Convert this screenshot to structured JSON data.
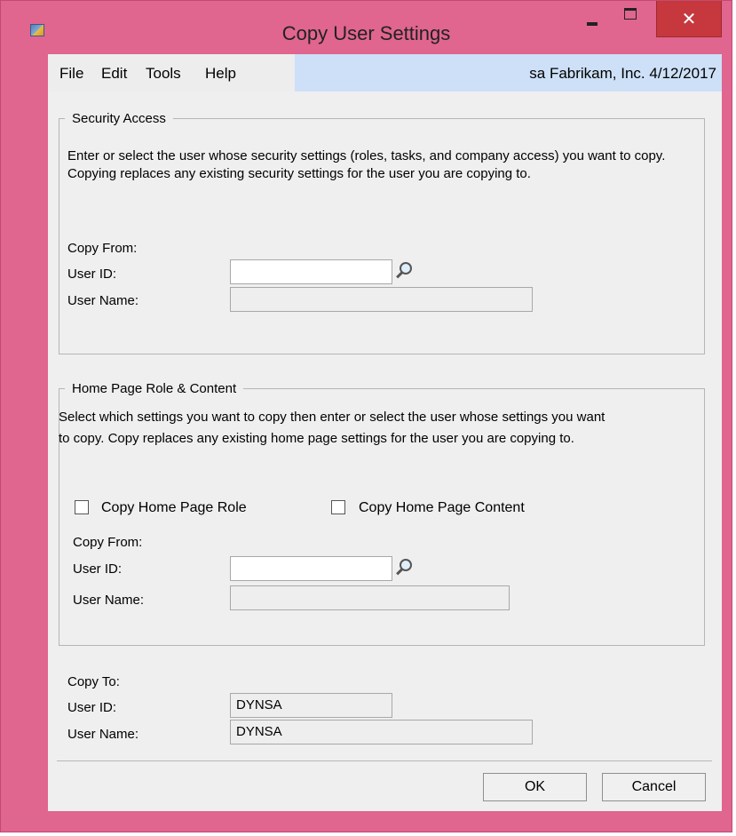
{
  "window": {
    "title": "Copy User Settings",
    "close_glyph": "✕"
  },
  "menu": {
    "items": [
      "File",
      "Edit",
      "Tools",
      "Help"
    ],
    "status": "sa  Fabrikam, Inc.  4/12/2017"
  },
  "security_access": {
    "legend": "Security Access",
    "description": "Enter or select the user whose security settings (roles, tasks, and company access) you want to copy. Copying replaces any existing security settings for the user you are copying to.",
    "copy_from_label": "Copy From:",
    "user_id_label": "User ID:",
    "user_id_value": "",
    "user_name_label": "User Name:",
    "user_name_value": ""
  },
  "home_page": {
    "legend": "Home Page Role & Content",
    "description": "Select which settings you want to copy then enter or select the user whose settings you want to copy.  Copy replaces any existing home page settings for the user you are copying to.",
    "copy_role_label": "Copy Home Page Role",
    "copy_role_checked": false,
    "copy_content_label": "Copy Home Page Content",
    "copy_content_checked": false,
    "copy_from_label": "Copy From:",
    "user_id_label": "User ID:",
    "user_id_value": "",
    "user_name_label": "User Name:",
    "user_name_value": ""
  },
  "copy_to": {
    "label": "Copy To:",
    "user_id_label": "User ID:",
    "user_id_value": "DYNSA",
    "user_name_label": "User Name:",
    "user_name_value": "DYNSA"
  },
  "buttons": {
    "ok": "OK",
    "cancel": "Cancel"
  },
  "colors": {
    "window_frame": "#e0658f",
    "close_button": "#c7383e",
    "status_bar": "#cde0f7",
    "client_background": "#efefef"
  }
}
